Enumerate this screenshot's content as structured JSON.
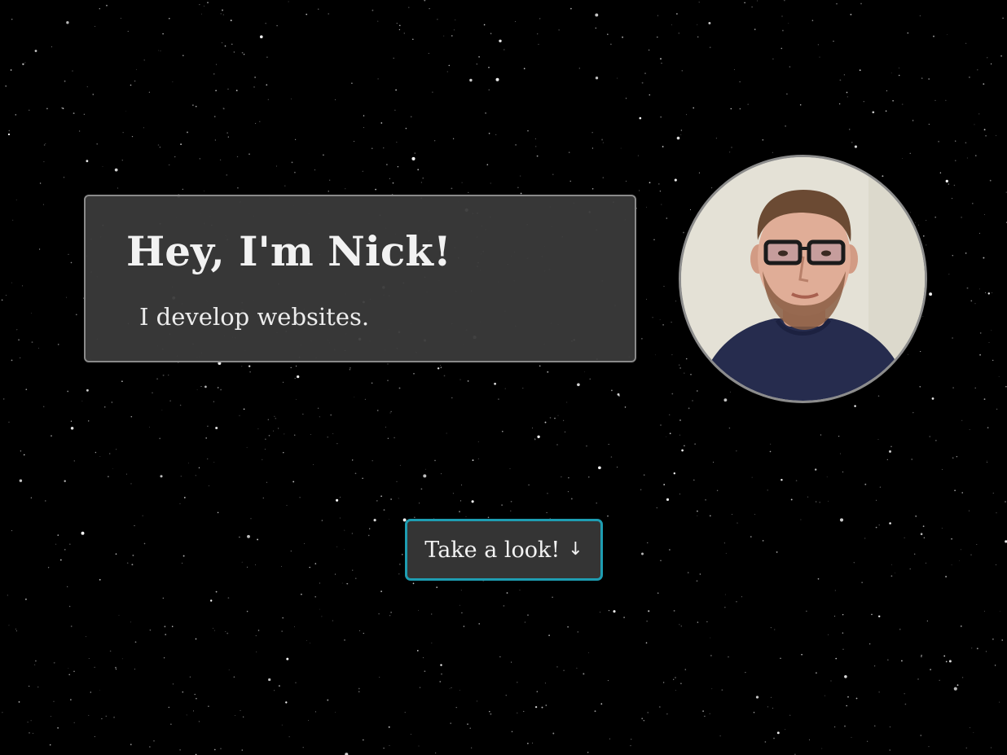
{
  "intro": {
    "title": "Hey, I'm Nick!",
    "subtitle": "I develop websites."
  },
  "cta": {
    "label": "Take a look!",
    "arrow": "↓"
  },
  "avatar": {
    "icon": "profile-photo"
  },
  "colors": {
    "background": "#000000",
    "card": "#3a3a3a",
    "card_border": "#8a8a8a",
    "accent": "#1e9db2",
    "text": "#f2f2f2"
  }
}
